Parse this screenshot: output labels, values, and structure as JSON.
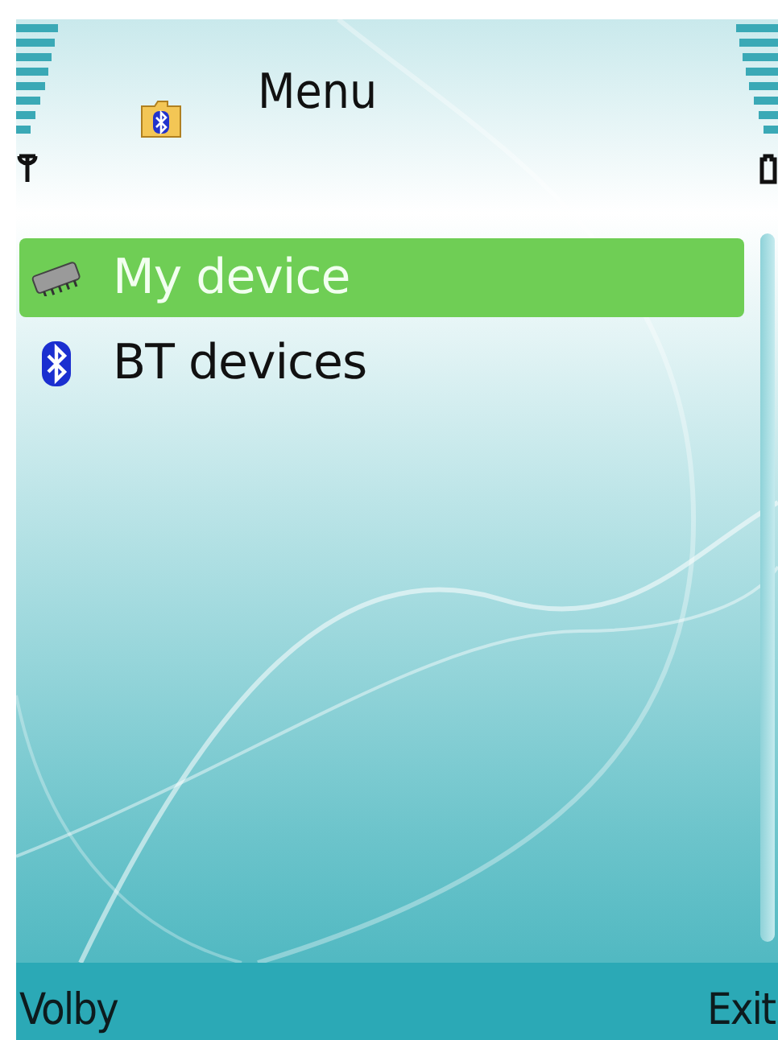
{
  "title": "Menu",
  "items": [
    {
      "label": "My device",
      "kind": "chip",
      "selected": true
    },
    {
      "label": "BT devices",
      "kind": "bluetooth",
      "selected": false
    }
  ],
  "softkeys": {
    "left": "Volby",
    "right": "Exit"
  }
}
